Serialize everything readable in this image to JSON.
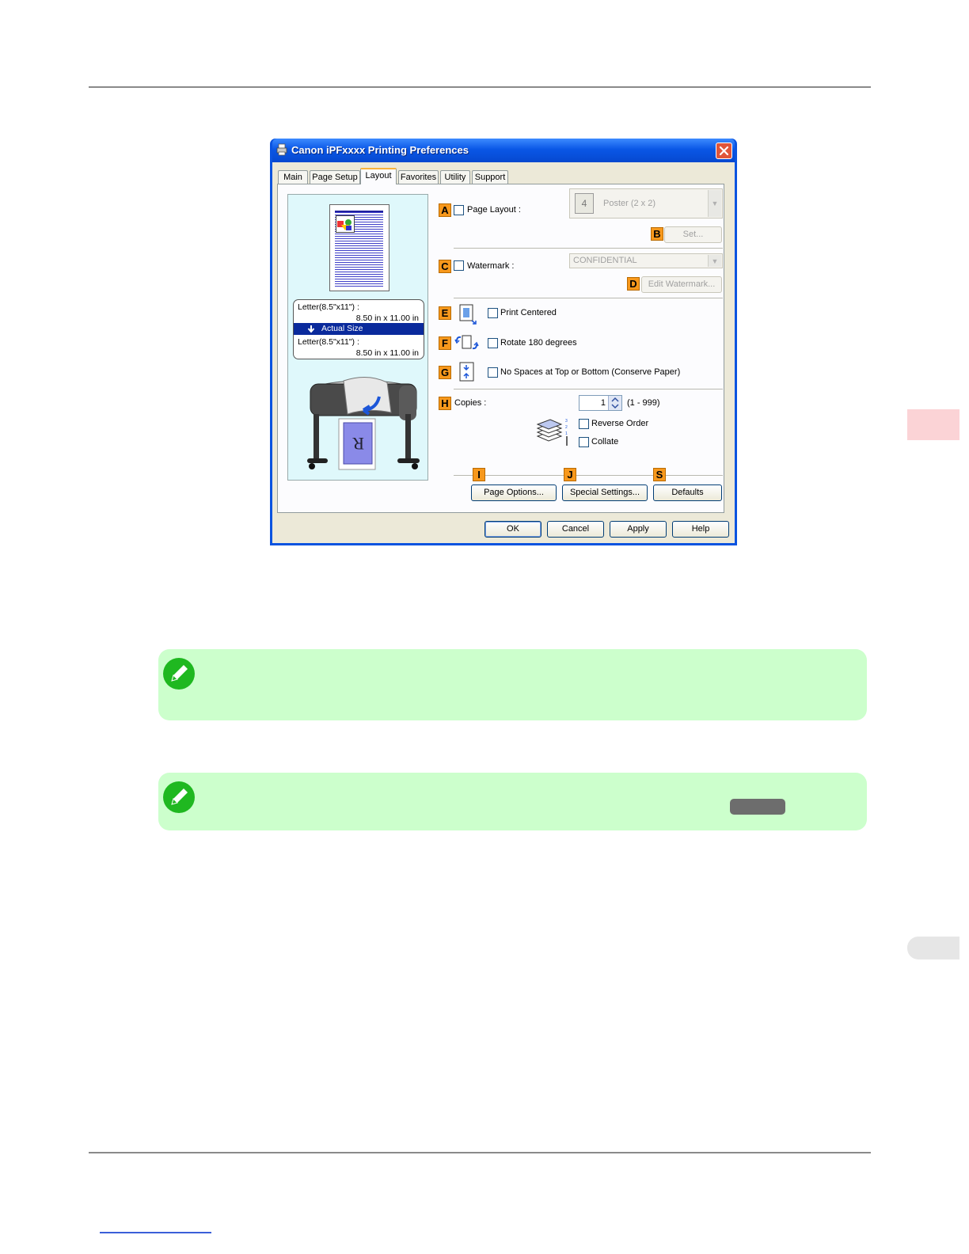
{
  "dialog": {
    "title": "Canon iPFxxxx Printing Preferences",
    "tabs": [
      {
        "label": "Main"
      },
      {
        "label": "Page Setup"
      },
      {
        "label": "Layout"
      },
      {
        "label": "Favorites"
      },
      {
        "label": "Utility"
      },
      {
        "label": "Support"
      }
    ],
    "preview": {
      "original_size": "Letter(8.5\"x11\") :",
      "original_dims": "8.50 in x 11.00 in",
      "mode": "Actual Size",
      "output_size": "Letter(8.5\"x11\") :",
      "output_dims": "8.50 in x 11.00 in"
    },
    "layout": {
      "page_layout_label": "Page Layout :",
      "page_layout_value": "Poster (2 x 2)",
      "page_layout_icon_text": "4",
      "set_button": "Set...",
      "watermark_label": "Watermark :",
      "watermark_value": "CONFIDENTIAL",
      "edit_watermark_button": "Edit Watermark...",
      "print_centered": "Print Centered",
      "rotate_180": "Rotate 180 degrees",
      "no_spaces": "No Spaces at Top or Bottom (Conserve Paper)",
      "copies_label": "Copies :",
      "copies_value": "1",
      "copies_range": "(1 - 999)",
      "reverse_order": "Reverse Order",
      "collate": "Collate",
      "page_options_button": "Page Options...",
      "special_settings_button": "Special Settings...",
      "defaults_button": "Defaults"
    },
    "badges": {
      "a": "A",
      "b": "B",
      "c": "C",
      "d": "D",
      "e": "E",
      "f": "F",
      "g": "G",
      "h": "H",
      "i": "I",
      "j": "J",
      "s": "S"
    },
    "footer": {
      "ok": "OK",
      "cancel": "Cancel",
      "apply": "Apply",
      "help": "Help"
    }
  },
  "colors": {
    "titlebar": "#0a57e6",
    "badge": "#f7981c",
    "note_bg": "#ccffcc",
    "side_tab": "#fbd3d6"
  }
}
